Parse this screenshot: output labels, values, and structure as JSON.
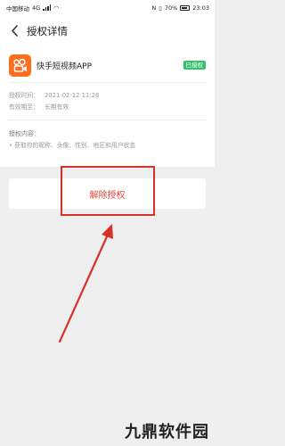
{
  "status_bar": {
    "carrier": "中国移动",
    "network": "4G",
    "battery": "70%",
    "time": "23:03"
  },
  "nav": {
    "title": "授权详情"
  },
  "app": {
    "name": "快手短视频APP",
    "badge": "已授权",
    "icon_color": "#ff6d1f"
  },
  "details": {
    "auth_time_label": "授权时间：",
    "auth_time_value": "2021-02-12 11:28",
    "validity_label": "有效期至：",
    "validity_value": "长期有效"
  },
  "permissions": {
    "title": "授权内容：",
    "items": [
      "• 获取你的昵称、头像、性别、地区和用户状态"
    ]
  },
  "actions": {
    "revoke_label": "解除授权"
  },
  "watermark": {
    "text": "九鼎软件园"
  },
  "colors": {
    "accent_red": "#e8473a",
    "badge_green": "#37c06a",
    "annotation_red": "#d6322a"
  }
}
